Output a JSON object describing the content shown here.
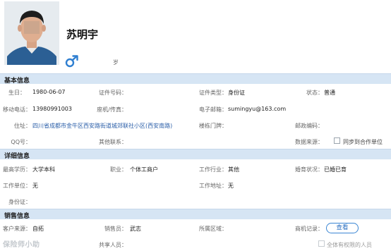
{
  "profile": {
    "name": "苏明宇",
    "age_unit": "岁"
  },
  "sections": {
    "basic": "基本信息",
    "detail": "详细信息",
    "sales": "销售信息"
  },
  "basic": {
    "birthday_label": "生日：",
    "birthday_value": "1980-06-07",
    "id_no_label": "证件号码：",
    "id_type_label": "证件类型：",
    "id_type_value": "身份证",
    "status_label": "状态：",
    "status_value": "普通",
    "mobile_label": "移动电话：",
    "mobile_value": "13980991003",
    "phone_label": "座机/传真：",
    "email_label": "电子邮箱：",
    "email_value": "sumingyu@163.com",
    "address_label": "住址：",
    "address_value": "四川省成都市金牛区西安路街道城郊联社小区(西安南路)",
    "house_label": "楼栋门牌：",
    "postcode_label": "邮政编码：",
    "qq_label": "QQ号：",
    "other_label": "其他联系：",
    "datasource_label": "数据来源：",
    "sync_label": "同步到合作单位"
  },
  "detail": {
    "education_label": "最高学历：",
    "education_value": "大学本科",
    "job_label": "职业：",
    "job_value": "个体工商户",
    "industry_label": "工作行业：",
    "industry_value": "其他",
    "marital_label": "婚育状况：",
    "marital_value": "已婚已育",
    "workplace_label": "工作单位：",
    "workplace_value": "无",
    "workaddr_label": "工作地址：",
    "workaddr_value": "无",
    "idcard_label": "身份证："
  },
  "sales": {
    "source_label": "客户来源：",
    "source_value": "自拓",
    "salesman_label": "销售员：",
    "salesman_value": "武志",
    "region_label": "所属区域：",
    "machine_label": "商机记录：",
    "view_button": "查看",
    "shared_label": "共享人员：",
    "all_label": "全体有权限的人员"
  },
  "watermark": "保险师小助",
  "icons": {
    "gender": "male-symbol-icon",
    "checkbox": "checkbox-icon"
  },
  "colors": {
    "section_bg": "#d6e5f4",
    "gender_blue": "#2f7fd1",
    "link_blue": "#2a5ea8",
    "button_border": "#3a86d4"
  }
}
